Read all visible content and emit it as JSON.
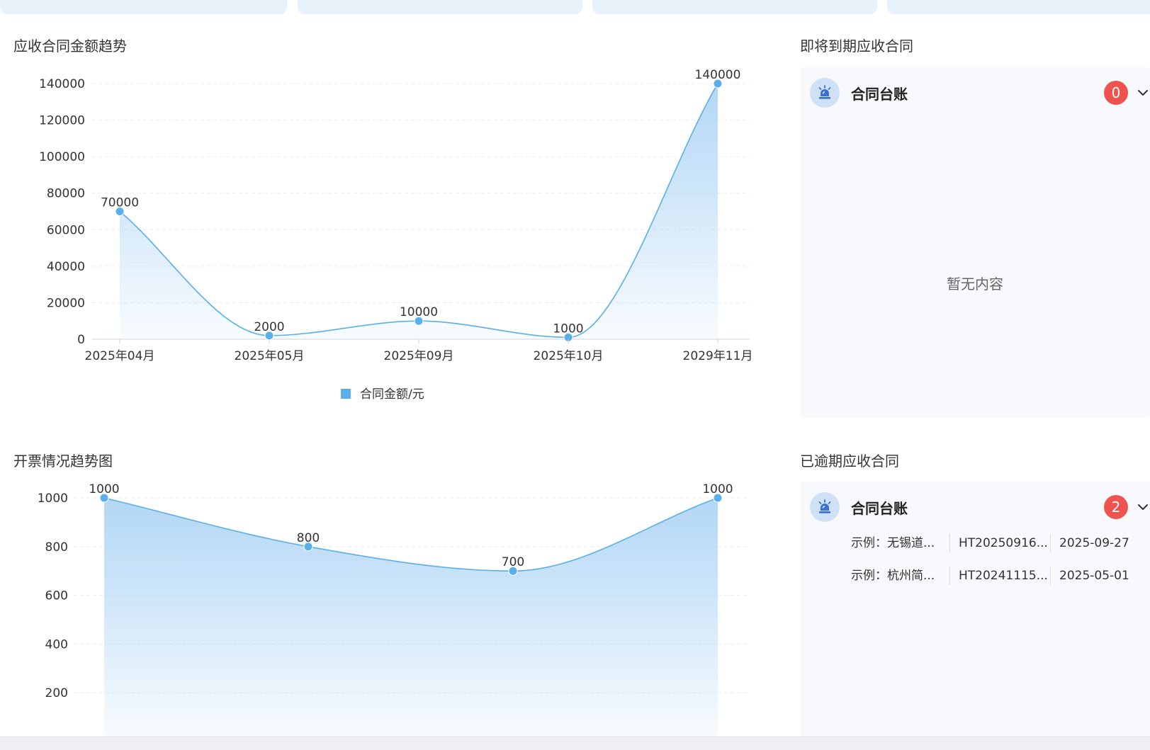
{
  "colors": {
    "accent": "#5aafea",
    "area_top": "#a9d2f4",
    "badge_red": "#ef5350",
    "icon_blue": "#3b6fd1"
  },
  "receivable_trend": {
    "title": "应收合同金额趋势",
    "legend": "合同金额/元"
  },
  "invoice_trend": {
    "title": "开票情况趋势图"
  },
  "upcoming": {
    "title": "即将到期应收合同",
    "panel_label": "合同台账",
    "count": "0",
    "empty_text": "暂无内容",
    "icon": "alarm-icon"
  },
  "overdue": {
    "title": "已逾期应收合同",
    "panel_label": "合同台账",
    "count": "2",
    "icon": "alarm-icon",
    "rows": [
      {
        "name": "示例：无锡道...",
        "code": "HT20250916...",
        "date": "2025-09-27"
      },
      {
        "name": "示例：杭州简...",
        "code": "HT20241115...",
        "date": "2025-05-01"
      }
    ]
  },
  "chart_data": [
    {
      "type": "area",
      "title": "应收合同金额趋势",
      "categories": [
        "2025年04月",
        "2025年05月",
        "2025年09月",
        "2025年10月",
        "2029年11月"
      ],
      "series": [
        {
          "name": "合同金额/元",
          "values": [
            70000,
            2000,
            10000,
            1000,
            140000
          ]
        }
      ],
      "ylim": [
        0,
        140000
      ],
      "yticks": [
        0,
        20000,
        40000,
        60000,
        80000,
        100000,
        120000,
        140000
      ],
      "smooth": true,
      "data_labels": true,
      "grid": true,
      "legend_position": "bottom"
    },
    {
      "type": "area",
      "title": "开票情况趋势图",
      "categories": [
        "",
        "",
        "",
        ""
      ],
      "series": [
        {
          "values": [
            1000,
            800,
            700,
            1000
          ]
        }
      ],
      "ylim": [
        0,
        1000
      ],
      "yticks": [
        200,
        400,
        600,
        800,
        1000
      ],
      "smooth": true,
      "data_labels": true,
      "grid": true
    }
  ]
}
